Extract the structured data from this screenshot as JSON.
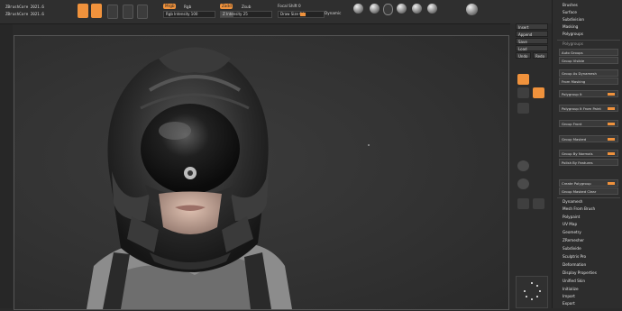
{
  "title_line_1": "ZBrushCore 2021.6",
  "title_line_2": "ZBrushCore 2021.6",
  "toolbar": {
    "draw_label": "Draw",
    "move_label": "Move",
    "scale_label": "Scale",
    "rotate_label": "Rotate",
    "mrgb_label": "Mrgb",
    "rgb_label": "Rgb",
    "m_label": "M",
    "zadd_label": "Zadd",
    "zsub_label": "Zsub",
    "focal_label": "Focal Shift 0",
    "draw_size_label": "Draw Size 64",
    "z_intensity_label": "Z Intensity 25",
    "rgb_intensity_label": "Rgb Intensity 100",
    "dynamic_label": "Dynamic",
    "brush_labels": [
      "Standard",
      "ClayBuildup",
      "Move",
      "DamStandard",
      "hPolish"
    ],
    "matcap_label": "MatCap"
  },
  "rail": {
    "buttons": [
      "Insert",
      "Append",
      "Save",
      "Load",
      "Undo",
      "Redo",
      "Vol",
      "SPix"
    ],
    "icons": [
      "Perspective",
      "Floor",
      "Local",
      "Frame",
      "Move",
      "Scale",
      "Rotate",
      "Transp"
    ]
  },
  "palette": {
    "top_items": [
      "Brushes",
      "Surface",
      "Subdivision",
      "Masking",
      "Polygroups"
    ],
    "subtitle": "Polygroups",
    "buttons": [
      "Auto Groups",
      "Group Visible",
      "Group As Dynamesh",
      "From Masking",
      "Polygroup It",
      "Polygroup It From Paint",
      "Group Front",
      "Group Masked",
      "Group By Normals",
      "Polish By Features",
      "Create Polygroup",
      "Group Masked Clear"
    ],
    "bottom_items": [
      "Dynamesh",
      "Mesh From Brush",
      "Polypaint",
      "UV Map",
      "Geometry",
      "ZRemesher",
      "Subdivide",
      "Sculptris Pro",
      "Deformation",
      "Display Properties",
      "Unified Skin",
      "Initialize",
      "Import",
      "Export"
    ]
  },
  "colors": {
    "accent": "#f0923c",
    "bg": "#2a2a2a",
    "panel": "#2d2d2d"
  }
}
